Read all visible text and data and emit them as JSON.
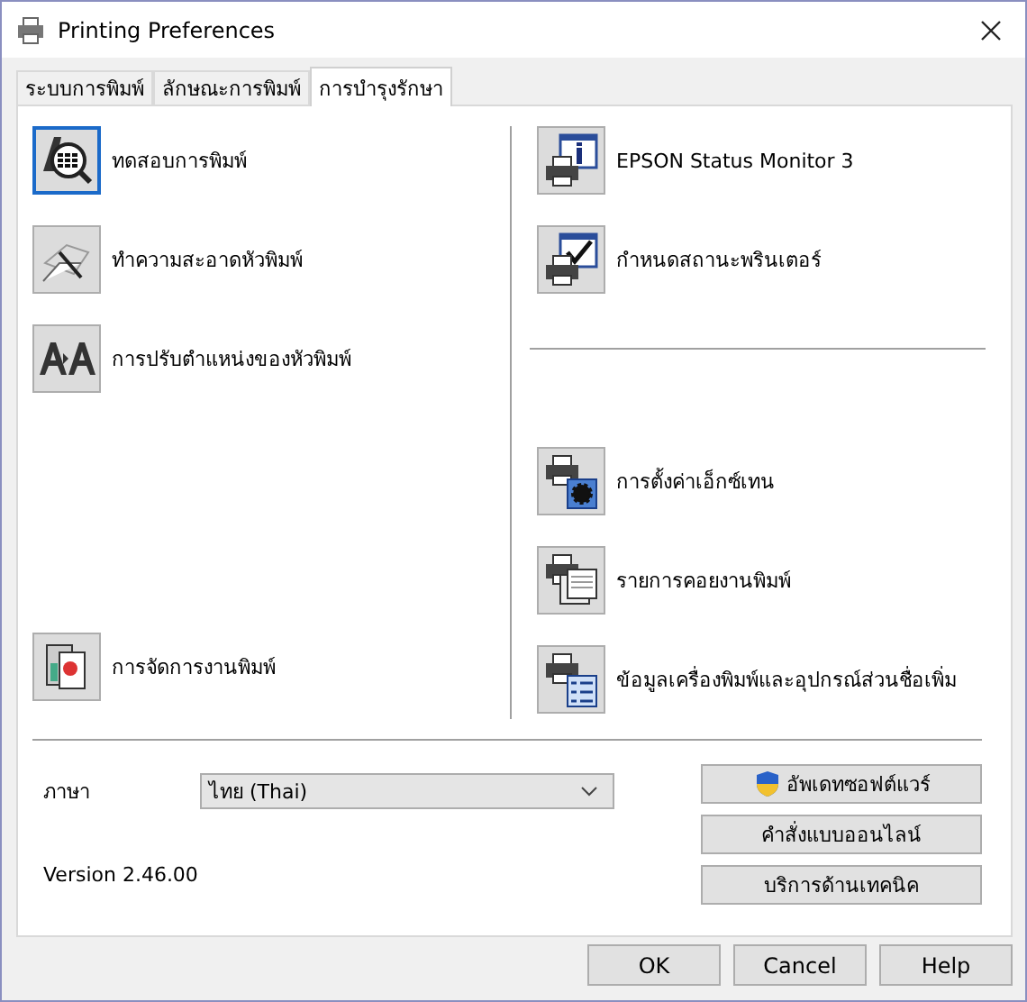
{
  "window": {
    "title": "Printing Preferences"
  },
  "tabs": [
    {
      "label": "ระบบการพิมพ์",
      "selected": false
    },
    {
      "label": "ลักษณะการพิมพ์",
      "selected": false
    },
    {
      "label": "การบำรุงรักษา",
      "selected": true
    }
  ],
  "left_tools": [
    {
      "kind": "nozzle_check",
      "label": "ทดสอบการพิมพ์",
      "selected": true
    },
    {
      "kind": "head_clean",
      "label": "ทำความสะอาดหัวพิมพ์",
      "selected": false
    },
    {
      "kind": "head_align",
      "label": "การปรับตำแหน่งของหัวพิมพ์",
      "selected": false
    }
  ],
  "left_bottom_tools": [
    {
      "kind": "job_manager",
      "label": "การจัดการงานพิมพ์",
      "selected": false
    }
  ],
  "right_top_tools": [
    {
      "kind": "status_monitor",
      "label": "EPSON Status Monitor 3",
      "selected": false
    },
    {
      "kind": "monitor_prefs",
      "label": "กำหนดสถานะพรินเตอร์",
      "selected": false
    }
  ],
  "right_bottom_tools": [
    {
      "kind": "extended",
      "label": "การตั้งค่าเอ็กซ์เทน",
      "selected": false
    },
    {
      "kind": "print_queue",
      "label": "รายการคอยงานพิมพ์",
      "selected": false
    },
    {
      "kind": "printer_info",
      "label": "ข้อมูลเครื่องพิมพ์และอุปกรณ์ส่วนชื่อเพิ่ม",
      "selected": false
    }
  ],
  "language": {
    "label": "ภาษา",
    "value": "ไทย (Thai)"
  },
  "version": "Version 2.46.00",
  "side_buttons": [
    {
      "kind": "shield",
      "label": "อัพเดทซอฟต์แวร์"
    },
    {
      "kind": "plain",
      "label": "คำสั่งแบบออนไลน์"
    },
    {
      "kind": "plain",
      "label": "บริการด้านเทคนิค"
    }
  ],
  "dialog_buttons": [
    "OK",
    "Cancel",
    "Help"
  ]
}
